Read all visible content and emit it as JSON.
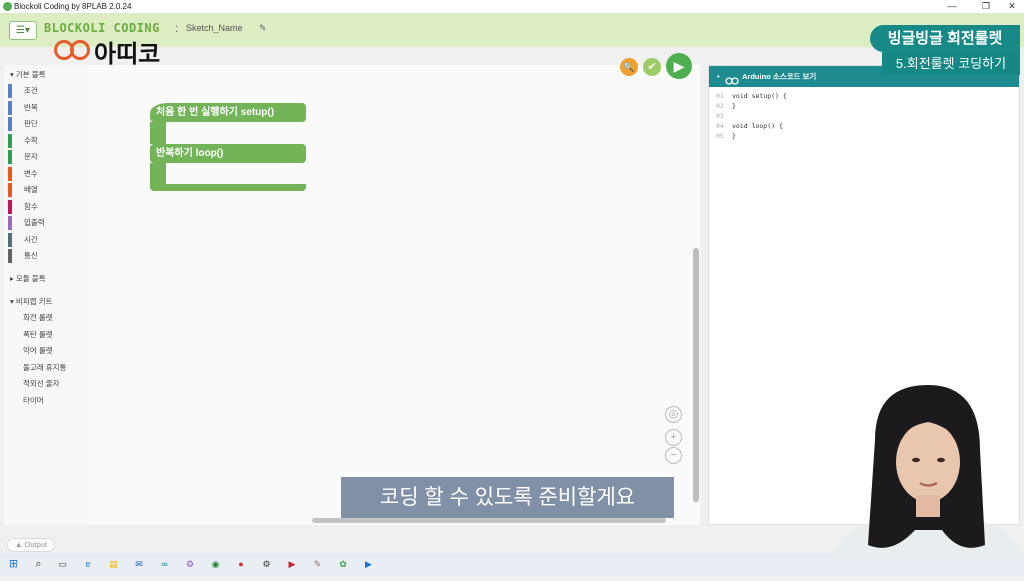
{
  "window": {
    "title": "Blockoli Coding by 8PLAB 2.0.24",
    "min_icon": "—",
    "max_icon": "❐",
    "close_icon": "✕"
  },
  "appbar": {
    "menu_icon": "☰▾",
    "brand": "BLOCKOLI CODING",
    "separator": ":",
    "sketch_name": "Sketch_Name",
    "edit_icon": "✎"
  },
  "logo": {
    "text": "아띠코"
  },
  "sidebar": {
    "basic_header": "▾ 기본 블록",
    "categories": [
      {
        "label": "조건",
        "color": "#5b80c4"
      },
      {
        "label": "반복",
        "color": "#5b80c4"
      },
      {
        "label": "판단",
        "color": "#5b80c4"
      },
      {
        "label": "수학",
        "color": "#2e9e4f"
      },
      {
        "label": "문자",
        "color": "#2e9e4f"
      },
      {
        "label": "변수",
        "color": "#e65a1f"
      },
      {
        "label": "배열",
        "color": "#e65a1f"
      },
      {
        "label": "함수",
        "color": "#c2185b"
      },
      {
        "label": "입출력",
        "color": "#9c6ab8"
      },
      {
        "label": "시간",
        "color": "#546e7a"
      },
      {
        "label": "통신",
        "color": "#616161"
      }
    ],
    "module_header": "▸ 모듈 블록",
    "kit_header": "▾ 비피랩 키트",
    "kits": [
      "회전 룰렛",
      "폭탄 룰렛",
      "악어 룰렛",
      "돌고래 휴지통",
      "적외선 줄자",
      "타이머"
    ]
  },
  "workspace": {
    "setup_block": "처음 한 번 실행하기 setup()",
    "loop_block": "반복하기 loop()",
    "zoom_icon": "🔍",
    "check_icon": "✔",
    "play_icon": "▶",
    "target_icon": "◎",
    "zoom_in_icon": "+",
    "zoom_out_icon": "−"
  },
  "code_panel": {
    "header": "Arduino 소스코드 보기",
    "lines": [
      {
        "n": "01",
        "code": "void setup() {"
      },
      {
        "n": "02",
        "code": "}"
      },
      {
        "n": "03",
        "code": ""
      },
      {
        "n": "04",
        "code": "void loop() {"
      },
      {
        "n": "05",
        "code": "}"
      }
    ]
  },
  "overlay": {
    "badge_title": "빙글빙글 회전룰렛",
    "badge_sub": "5.회전룰렛 코딩하기",
    "subtitle": "코딩 할 수 있도록 준비할게요"
  },
  "output": {
    "label": "▲ Output"
  },
  "taskbar": {
    "start_icon": "⊞",
    "search_icon": "⌕",
    "icons": [
      "▭",
      "e",
      "▤",
      "✉",
      "∞",
      "⚙",
      "◉",
      "●",
      "⚙",
      "▶",
      "✎",
      "✿",
      "▶"
    ]
  }
}
